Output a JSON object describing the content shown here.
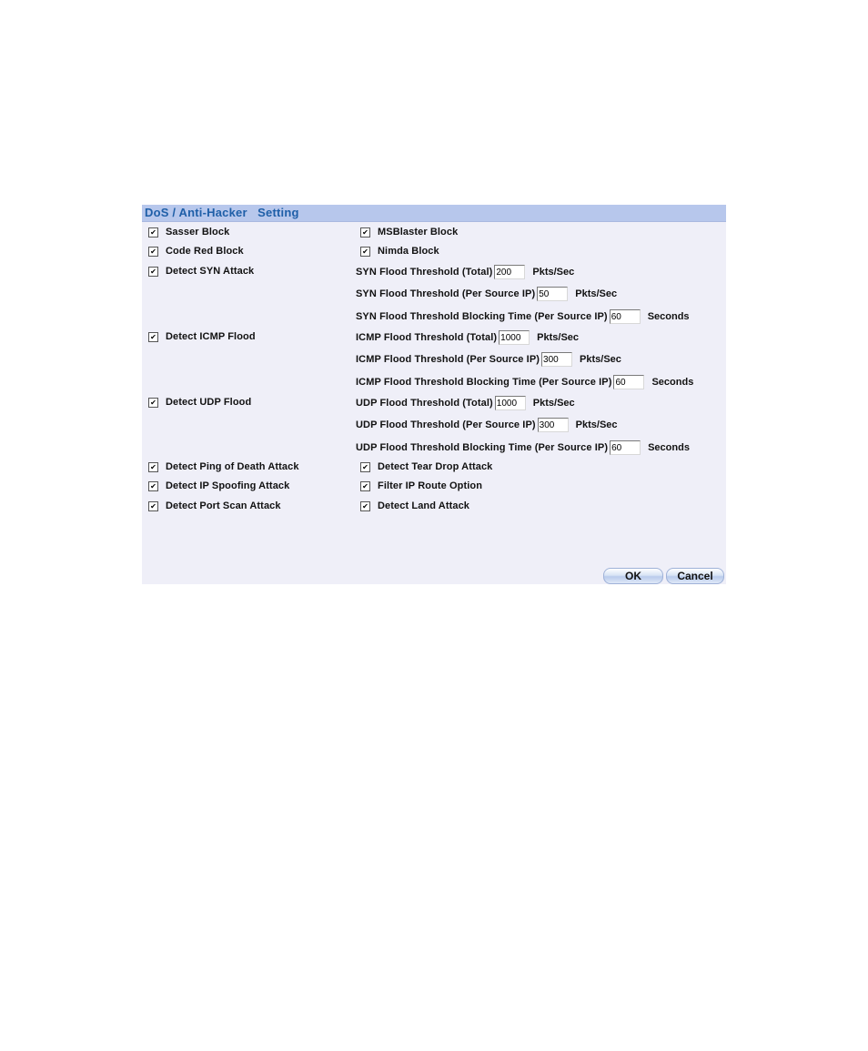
{
  "panel": {
    "title": "DoS / Anti-Hacker   Setting",
    "header_color": "#B7C7EC",
    "title_color": "#1F5FA8",
    "body_color": "#EFEFF8"
  },
  "left_options": [
    {
      "label": "Sasser Block",
      "checked": true
    },
    {
      "label": "Code Red Block",
      "checked": true
    },
    {
      "label": "Detect SYN Attack",
      "checked": true
    },
    {
      "label": "Detect ICMP Flood",
      "checked": true
    },
    {
      "label": "Detect UDP Flood",
      "checked": true
    },
    {
      "label": "Detect Ping of Death Attack",
      "checked": true
    },
    {
      "label": "Detect IP Spoofing Attack",
      "checked": true
    },
    {
      "label": "Detect Port Scan Attack",
      "checked": true
    }
  ],
  "right_options": [
    {
      "label": "MSBlaster Block",
      "checked": true
    },
    {
      "label": "Nimda Block",
      "checked": true
    },
    {
      "label": "Detect Tear Drop Attack",
      "checked": true
    },
    {
      "label": "Filter IP Route Option",
      "checked": true
    },
    {
      "label": "Detect Land Attack",
      "checked": true
    }
  ],
  "thresholds": {
    "syn": [
      {
        "label": "SYN Flood Threshold (Total)",
        "value": "200",
        "unit": "Pkts/Sec"
      },
      {
        "label": "SYN Flood Threshold (Per Source IP)",
        "value": "50",
        "unit": "Pkts/Sec"
      },
      {
        "label": "SYN Flood Threshold Blocking Time (Per Source IP)",
        "value": "60",
        "unit": "Seconds"
      }
    ],
    "icmp": [
      {
        "label": "ICMP Flood Threshold (Total)",
        "value": "1000",
        "unit": "Pkts/Sec"
      },
      {
        "label": "ICMP Flood Threshold (Per Source IP)",
        "value": "300",
        "unit": "Pkts/Sec"
      },
      {
        "label": "ICMP Flood Threshold Blocking Time (Per Source IP)",
        "value": "60",
        "unit": "Seconds"
      }
    ],
    "udp": [
      {
        "label": "UDP Flood Threshold (Total)",
        "value": "1000",
        "unit": "Pkts/Sec"
      },
      {
        "label": "UDP Flood Threshold (Per Source IP)",
        "value": "300",
        "unit": "Pkts/Sec"
      },
      {
        "label": "UDP Flood Threshold Blocking Time (Per Source IP)",
        "value": "60",
        "unit": "Seconds"
      }
    ]
  },
  "buttons": {
    "ok_label": "OK",
    "cancel_label": "Cancel"
  }
}
